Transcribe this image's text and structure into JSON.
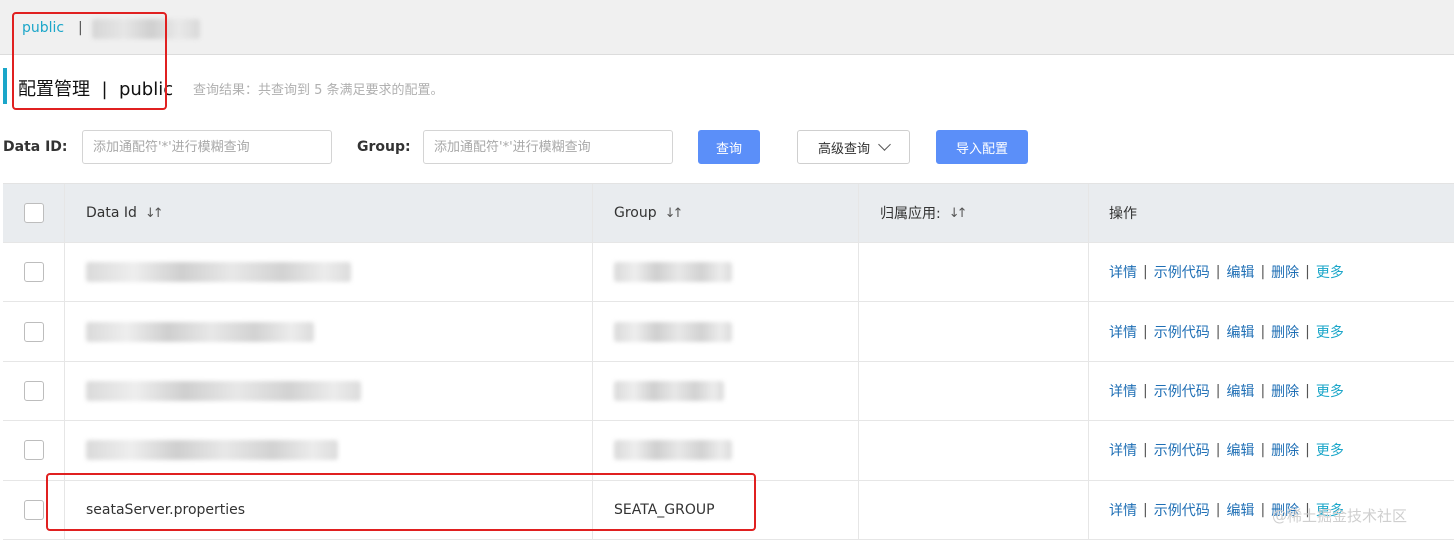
{
  "namespace_bar": {
    "current": "public",
    "separator": "|"
  },
  "header": {
    "title": "配置管理  |  public",
    "query_result": "查询结果：共查询到 5 条满足要求的配置。"
  },
  "search": {
    "data_id_label": "Data ID:",
    "data_id_placeholder": "添加通配符'*'进行模糊查询",
    "group_label": "Group:",
    "group_placeholder": "添加通配符'*'进行模糊查询",
    "query_button": "查询",
    "advanced_button": "高级查询",
    "import_button": "导入配置"
  },
  "table": {
    "columns": {
      "data_id": "Data Id",
      "group": "Group",
      "app": "归属应用:",
      "ops": "操作"
    },
    "sort_icon": "sort-icon",
    "actions": {
      "detail": "详情",
      "sample_code": "示例代码",
      "edit": "编辑",
      "delete": "删除",
      "more": "更多"
    },
    "rows": [
      {
        "data_id": "",
        "group": "",
        "app": ""
      },
      {
        "data_id": "",
        "group": "",
        "app": ""
      },
      {
        "data_id": "",
        "group": "",
        "app": ""
      },
      {
        "data_id": "",
        "group": "",
        "app": ""
      },
      {
        "data_id": "seataServer.properties",
        "group": "SEATA_GROUP",
        "app": ""
      }
    ]
  },
  "watermark": "@稀土掘金技术社区",
  "colors": {
    "accent": "#1ba6c9",
    "primary_button": "#5b8ff9",
    "link": "#1f6fb5",
    "highlight_box": "#e02020"
  }
}
